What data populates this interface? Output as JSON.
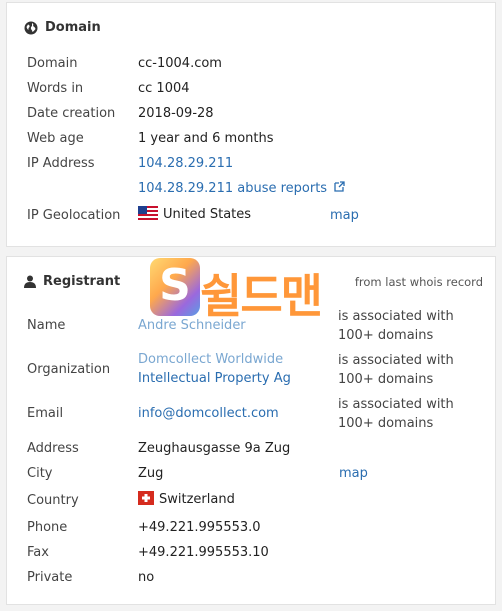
{
  "domain_card": {
    "title": "Domain",
    "rows": {
      "domain": {
        "label": "Domain",
        "value": "cc-1004.com"
      },
      "words": {
        "label": "Words in",
        "value": "cc 1004"
      },
      "created": {
        "label": "Date creation",
        "value": "2018-09-28"
      },
      "age": {
        "label": "Web age",
        "value": "1 year and 6 months"
      },
      "ip": {
        "label": "IP Address",
        "value": "104.28.29.211",
        "abuse": "104.28.29.211 abuse reports"
      },
      "geo": {
        "label": "IP Geolocation",
        "value": "United States",
        "map": "map"
      }
    }
  },
  "registrant_card": {
    "title": "Registrant",
    "note": "from last whois record",
    "rows": {
      "name": {
        "label": "Name",
        "value": "Andre Schneider",
        "extra": "is associated with 100+ domains"
      },
      "org": {
        "label": "Organization",
        "value_line1": "Domcollect Worldwide",
        "value_line2": "Intellectual Property Ag",
        "extra": "is associated with 100+ domains"
      },
      "email": {
        "label": "Email",
        "value": "info@domcollect.com",
        "extra": "is associated with 100+ domains"
      },
      "address": {
        "label": "Address",
        "value": "Zeughausgasse 9a Zug"
      },
      "city": {
        "label": "City",
        "value": "Zug",
        "map": "map"
      },
      "country": {
        "label": "Country",
        "value": "Switzerland"
      },
      "phone": {
        "label": "Phone",
        "value": "+49.221.995553.0"
      },
      "fax": {
        "label": "Fax",
        "value": "+49.221.995553.10"
      },
      "private": {
        "label": "Private",
        "value": "no"
      }
    }
  },
  "watermark": {
    "letter": "S",
    "text": "쉴드맨"
  },
  "colors": {
    "link": "#2a6db0",
    "link_light": "#7aa7d1",
    "watermark": "#ff8c24"
  }
}
